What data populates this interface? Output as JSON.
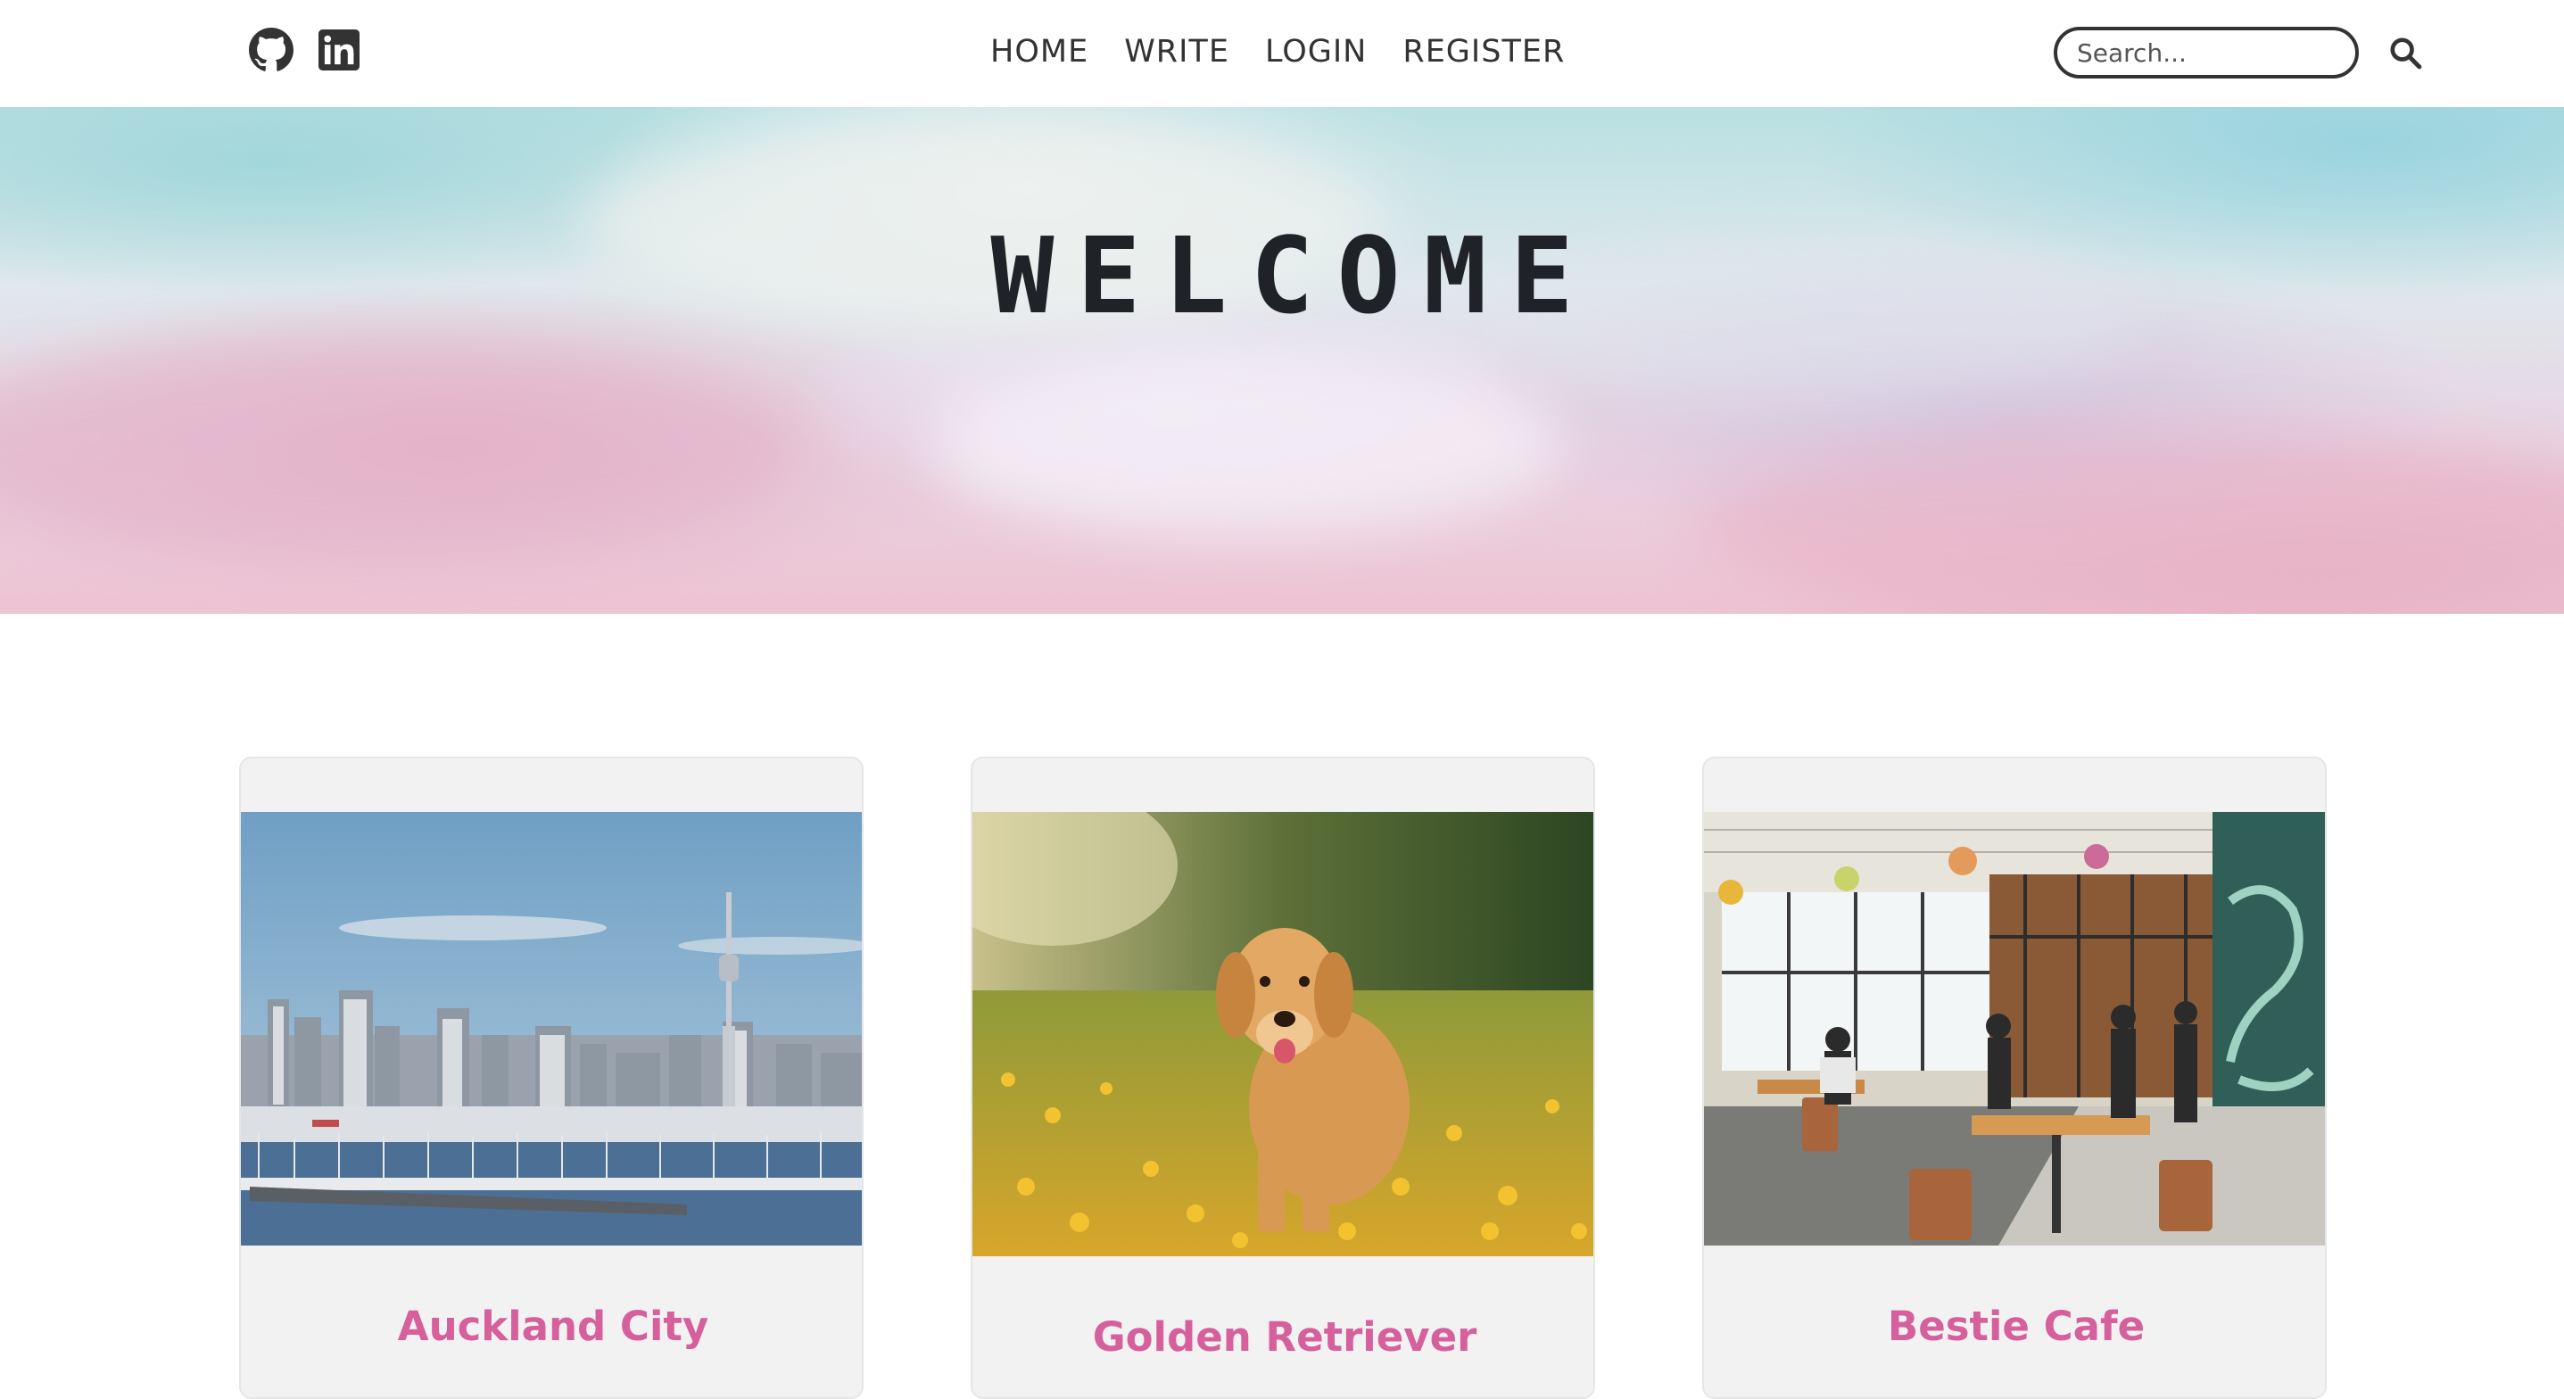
{
  "nav": {
    "social": [
      {
        "icon": "github-icon"
      },
      {
        "icon": "linkedin-icon"
      }
    ],
    "links": [
      {
        "label": "HOME"
      },
      {
        "label": "WRITE"
      },
      {
        "label": "LOGIN"
      },
      {
        "label": "REGISTER"
      }
    ],
    "search": {
      "placeholder": "Search...",
      "value": "",
      "icon": "search-icon"
    }
  },
  "hero": {
    "title": "WELCOME"
  },
  "posts": [
    {
      "title": "Auckland City",
      "image": "auckland-skyline-photo"
    },
    {
      "title": "Golden Retriever",
      "image": "golden-retriever-photo"
    },
    {
      "title": "Bestie Cafe",
      "image": "cafe-interior-photo"
    }
  ],
  "colors": {
    "accent": "#d6609c",
    "text": "#333333",
    "card_bg": "#f2f2f2"
  }
}
